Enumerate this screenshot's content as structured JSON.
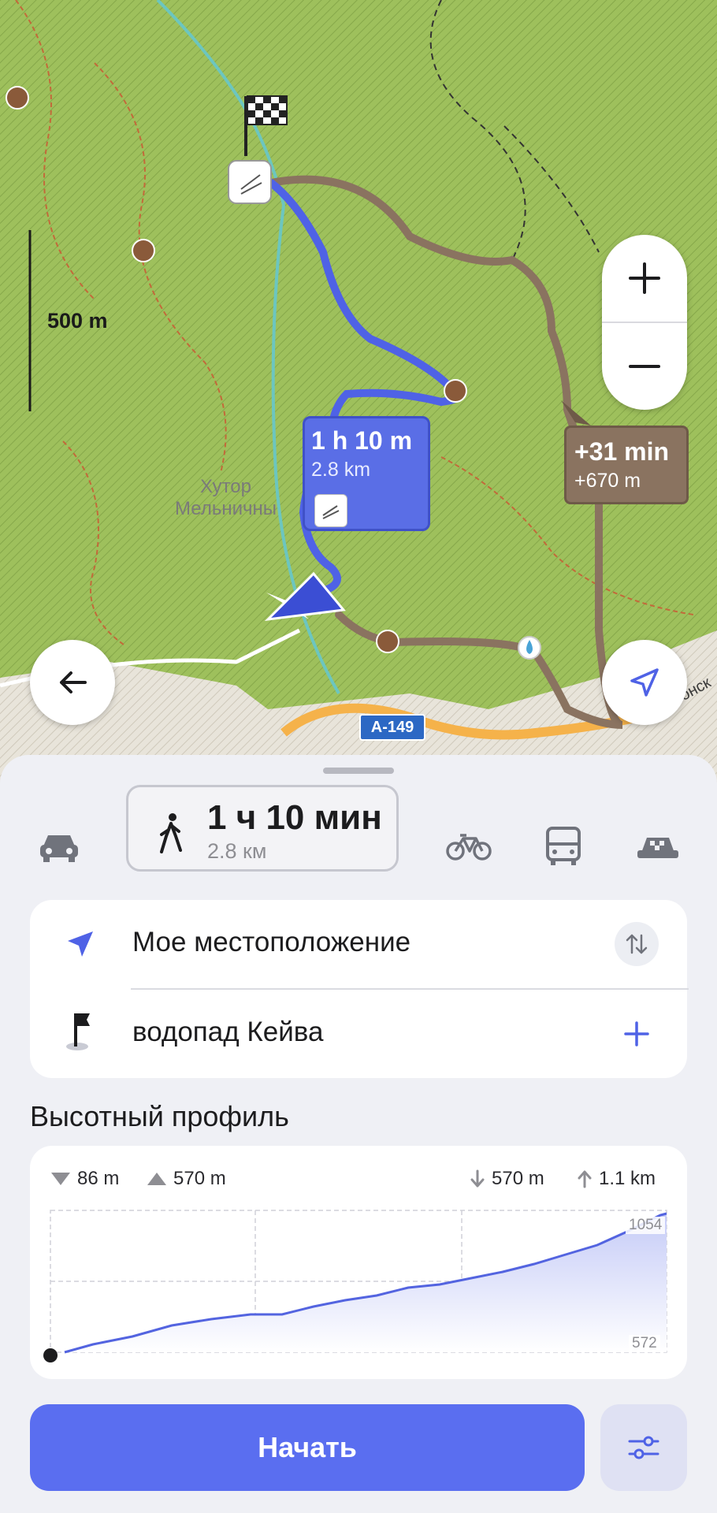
{
  "map": {
    "scale_label": "500 m",
    "place_name_line1": "Хутор",
    "place_name_line2": "Мельничны",
    "road_badge": "А-149",
    "street_label": "Эстонск",
    "route_bubble": {
      "duration": "1 h 10 m",
      "distance": "2.8 km"
    },
    "alt_bubble": {
      "extra_time": "+31 min",
      "extra_dist": "+670 m"
    },
    "colors": {
      "forest": "#9cbf5a",
      "route": "#4f62e6",
      "alt_route": "#8a7360"
    }
  },
  "transport": {
    "selected_duration": "1 ч 10 мин",
    "selected_distance": "2.8 км",
    "modes": [
      "car-icon",
      "walk-icon",
      "bicycle-icon",
      "bus-icon",
      "taxi-icon"
    ]
  },
  "route": {
    "from": "Мое местоположение",
    "to": "водопад Кейва"
  },
  "elevation": {
    "title": "Высотный профиль",
    "min_alt": "86 m",
    "max_alt": "570 m",
    "descent": "570 m",
    "ascent": "1.1 km",
    "axis_top": "1054",
    "axis_bottom": "572"
  },
  "actions": {
    "start_label": "Начать"
  }
}
